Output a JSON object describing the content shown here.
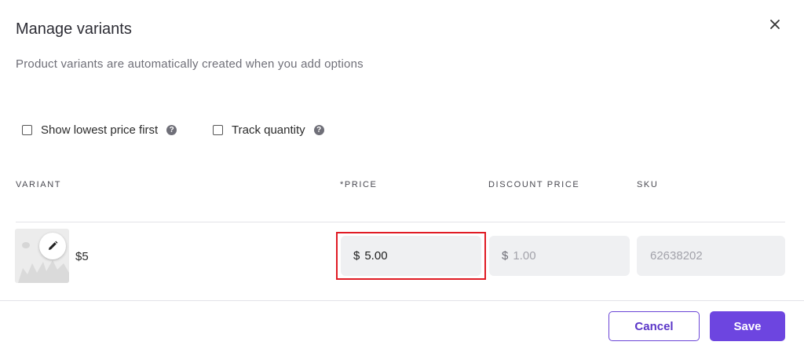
{
  "dialog": {
    "title": "Manage variants",
    "subtitle": "Product variants are automatically created when you add options",
    "close_icon": "close-icon"
  },
  "options": [
    {
      "label": "Show lowest price first",
      "checked": false,
      "help_glyph": "?"
    },
    {
      "label": "Track quantity",
      "checked": false,
      "help_glyph": "?"
    }
  ],
  "table": {
    "headers": [
      "VARIANT",
      "*PRICE",
      "DISCOUNT PRICE",
      "SKU"
    ],
    "rows": [
      {
        "name": "$5",
        "image": "image-placeholder",
        "edit_icon": "pencil-icon",
        "price": {
          "currency": "$",
          "value": "5.00"
        },
        "discount": {
          "currency": "$",
          "placeholder": "1.00"
        },
        "sku": {
          "placeholder": "62638202"
        }
      }
    ]
  },
  "footer": {
    "cancel_label": "Cancel",
    "save_label": "Save"
  },
  "colors": {
    "accent": "#6d45e0",
    "highlight_border": "#e01b24",
    "field_bg": "#eff0f2"
  }
}
